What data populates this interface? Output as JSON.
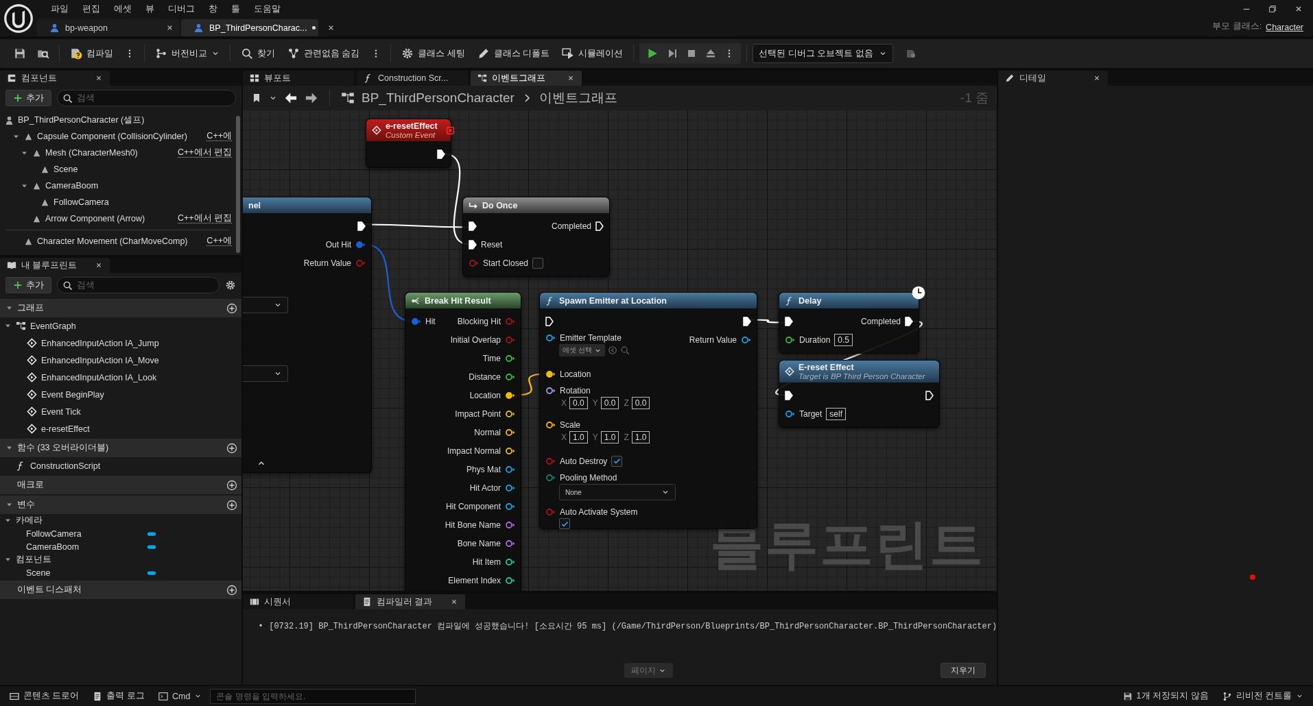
{
  "menu_bar": {
    "items": [
      "파일",
      "편집",
      "에셋",
      "뷰",
      "디버그",
      "창",
      "툴",
      "도움말"
    ]
  },
  "document_tabs": [
    {
      "label": "bp-weapon",
      "selected": false,
      "modified": false
    },
    {
      "label": "BP_ThirdPersonCharac...",
      "selected": true,
      "modified": true
    }
  ],
  "parent_class": {
    "label": "부모 클래스:",
    "value": "Character"
  },
  "toolbar": {
    "buttons": [
      "컴파일",
      "버전비교",
      "찾기",
      "관련없음 숨김",
      "클래스 세팅",
      "클래스 디폴트",
      "시뮬레이션"
    ],
    "debug_object": "선택된 디버그 오브젝트 없음"
  },
  "components_panel": {
    "tab": "컴포넌트",
    "add": "추가",
    "search_placeholder": "검색",
    "tree": [
      {
        "label": "BP_ThirdPersonCharacter (셀프)",
        "children": [
          {
            "label": "Capsule Component (CollisionCylinder)",
            "edit_link": "C++에",
            "expanded": true,
            "children": [
              {
                "label": "Mesh (CharacterMesh0)",
                "edit_link": "C++에서 편집",
                "expanded": true,
                "children": [
                  {
                    "label": "Scene"
                  }
                ]
              },
              {
                "label": "CameraBoom",
                "expanded": true,
                "children": [
                  {
                    "label": "FollowCamera"
                  }
                ]
              },
              {
                "label": "Arrow Component (Arrow)",
                "edit_link": "C++에서 편집"
              }
            ]
          }
        ]
      }
    ],
    "movement": [
      {
        "label": "Character Movement (CharMoveComp)",
        "edit_link": "C++에"
      }
    ]
  },
  "my_blueprint": {
    "tab": "내 블루프린트",
    "add": "추가",
    "search_placeholder": "검색",
    "sections": [
      {
        "title": "그래프",
        "expanded": true,
        "items": [
          {
            "label": "EventGraph",
            "kind": "graph",
            "expanded": true,
            "children": [
              {
                "label": "EnhancedInputAction IA_Jump",
                "kind": "event"
              },
              {
                "label": "EnhancedInputAction IA_Move",
                "kind": "event"
              },
              {
                "label": "EnhancedInputAction IA_Look",
                "kind": "event"
              },
              {
                "label": "Event BeginPlay",
                "kind": "event"
              },
              {
                "label": "Event Tick",
                "kind": "event"
              },
              {
                "label": "e-resetEffect",
                "kind": "event"
              }
            ]
          }
        ]
      },
      {
        "title": "함수 (33 오버라이더블)",
        "expanded": true,
        "items": [
          {
            "label": "ConstructionScript",
            "kind": "function"
          }
        ]
      },
      {
        "title": "매크로"
      },
      {
        "title": "변수",
        "expanded": true,
        "items": [
          {
            "label": "카메라",
            "kind": "category",
            "expanded": true,
            "children": [
              {
                "label": "FollowCamera",
                "kind": "variable"
              },
              {
                "label": "CameraBoom",
                "kind": "variable"
              }
            ]
          },
          {
            "label": "컴포넌트",
            "kind": "category",
            "expanded": true,
            "children": [
              {
                "label": "Scene",
                "kind": "variable"
              }
            ]
          }
        ]
      },
      {
        "title": "이벤트 디스패처"
      }
    ]
  },
  "graph_tabs": [
    {
      "label": "뷰포트",
      "selected": false
    },
    {
      "label": "Construction Scr...",
      "selected": false
    },
    {
      "label": "이벤트그래프",
      "selected": true
    }
  ],
  "breadcrumb": {
    "items": [
      "BP_ThirdPersonCharacter",
      "이벤트그래프"
    ],
    "zoom": "-1 줌"
  },
  "graph": {
    "watermark": "블루프린트",
    "nodes": [
      {
        "title": "e-resetEffect",
        "subtitle": "Custom Event",
        "kind": "event",
        "rows": [
          {
            "right": {
              "kind": "exec",
              "connected": true
            }
          }
        ]
      },
      {
        "title": "nel",
        "kind": "function",
        "advanced_expanded": true,
        "rows": [
          {
            "right": {
              "kind": "exec",
              "connected": true
            }
          },
          {
            "right": {
              "kind": "data",
              "label": "Out Hit",
              "color": "#1a5fd8",
              "connected": true
            }
          },
          {
            "right": {
              "kind": "data",
              "label": "Return Value",
              "color": "#a81414",
              "connected": false
            }
          },
          {
            "kind": "dropdown"
          },
          {
            "kind": "dropdown"
          }
        ]
      },
      {
        "title": "Do Once",
        "kind": "macro",
        "rows": [
          {
            "left": {
              "kind": "exec",
              "connected": true
            },
            "right": {
              "kind": "exec",
              "label": "Completed",
              "connected": false
            }
          },
          {
            "left": {
              "kind": "exec",
              "label": "Reset",
              "connected": true
            }
          },
          {
            "left": {
              "kind": "data",
              "label": "Start Closed",
              "color": "#a81414",
              "connected": false,
              "widget": {
                "kind": "checkbox",
                "checked": false
              }
            }
          }
        ]
      },
      {
        "title": "Break Hit Result",
        "kind": "pure",
        "rows": [
          {
            "left": {
              "kind": "data",
              "label": "Hit",
              "color": "#1a5fd8",
              "connected": true
            },
            "right": {
              "kind": "data",
              "label": "Blocking Hit",
              "color": "#a81414",
              "connected": false
            }
          },
          {
            "right": {
              "kind": "data",
              "label": "Initial Overlap",
              "color": "#a81414",
              "connected": false
            }
          },
          {
            "right": {
              "kind": "data",
              "label": "Time",
              "color": "#38c038",
              "connected": false
            }
          },
          {
            "right": {
              "kind": "data",
              "label": "Distance",
              "color": "#38c038",
              "connected": false
            }
          },
          {
            "right": {
              "kind": "data",
              "label": "Location",
              "color": "#f0b818",
              "connected": true
            }
          },
          {
            "right": {
              "kind": "data",
              "label": "Impact Point",
              "color": "#f0b818",
              "connected": false
            }
          },
          {
            "right": {
              "kind": "data",
              "label": "Normal",
              "color": "#f0b818",
              "connected": false
            }
          },
          {
            "right": {
              "kind": "data",
              "label": "Impact Normal",
              "color": "#f0b818",
              "connected": false
            }
          },
          {
            "right": {
              "kind": "data",
              "label": "Phys Mat",
              "color": "#18a0e8",
              "connected": false
            }
          },
          {
            "right": {
              "kind": "data",
              "label": "Hit Actor",
              "color": "#18a0e8",
              "connected": false
            }
          },
          {
            "right": {
              "kind": "data",
              "label": "Hit Component",
              "color": "#18a0e8",
              "connected": false
            }
          },
          {
            "right": {
              "kind": "data",
              "label": "Hit Bone Name",
              "color": "#b464e8",
              "connected": false
            }
          },
          {
            "right": {
              "kind": "data",
              "label": "Bone Name",
              "color": "#b464e8",
              "connected": false
            }
          },
          {
            "right": {
              "kind": "data",
              "label": "Hit Item",
              "color": "#1ec8a0",
              "connected": false
            }
          },
          {
            "right": {
              "kind": "data",
              "label": "Element Index",
              "color": "#1ec8a0",
              "connected": false
            }
          }
        ]
      },
      {
        "title": "Spawn Emitter at Location",
        "kind": "function",
        "rows": [
          {
            "left": {
              "kind": "exec",
              "connected": false
            },
            "right": {
              "kind": "exec",
              "connected": true
            }
          },
          {
            "left": {
              "kind": "data",
              "label": "Emitter Template",
              "color": "#18a0e8",
              "connected": false,
              "widget": {
                "kind": "asset",
                "value": "에셋 선택"
              }
            },
            "right": {
              "kind": "data",
              "label": "Return Value",
              "color": "#18a0e8",
              "connected": false
            }
          },
          {
            "left": {
              "kind": "data",
              "label": "Location",
              "color": "#f0b818",
              "connected": true
            }
          },
          {
            "left": {
              "kind": "data",
              "label": "Rotation",
              "color": "#9aa0f0",
              "connected": false,
              "widget": {
                "kind": "vector",
                "fields": [
                  {
                    "axis": "X",
                    "value": "0.0"
                  },
                  {
                    "axis": "Y",
                    "value": "0.0"
                  },
                  {
                    "axis": "Z",
                    "value": "0.0"
                  }
                ]
              }
            }
          },
          {
            "left": {
              "kind": "data",
              "label": "Scale",
              "color": "#f0b818",
              "connected": false,
              "widget": {
                "kind": "vector",
                "fields": [
                  {
                    "axis": "X",
                    "value": "1.0"
                  },
                  {
                    "axis": "Y",
                    "value": "1.0"
                  },
                  {
                    "axis": "Z",
                    "value": "1.0"
                  }
                ]
              }
            }
          },
          {
            "left": {
              "kind": "data",
              "label": "Auto Destroy",
              "color": "#a81414",
              "connected": false,
              "widget": {
                "kind": "checkbox",
                "checked": true
              }
            }
          },
          {
            "left": {
              "kind": "data",
              "label": "Pooling Method",
              "color": "#108070",
              "connected": false,
              "widget": {
                "kind": "dropdown",
                "value": "None"
              }
            }
          },
          {
            "left": {
              "kind": "data",
              "label": "Auto Activate System",
              "color": "#a81414",
              "connected": false,
              "stacked": true,
              "widget": {
                "kind": "checkbox",
                "checked": true
              }
            }
          }
        ]
      },
      {
        "title": "Delay",
        "kind": "function",
        "latent": true,
        "rows": [
          {
            "left": {
              "kind": "exec",
              "connected": true
            },
            "right": {
              "kind": "exec",
              "label": "Completed",
              "connected": true
            }
          },
          {
            "left": {
              "kind": "data",
              "label": "Duration",
              "color": "#38c038",
              "connected": false,
              "widget": {
                "kind": "text",
                "value": "0.5"
              }
            }
          }
        ]
      },
      {
        "title": "E-reset Effect",
        "subtitle": "Target is BP Third Person Character",
        "kind": "event_call",
        "rows": [
          {
            "left": {
              "kind": "exec",
              "connected": true
            },
            "right": {
              "kind": "exec",
              "connected": false
            }
          },
          {
            "left": {
              "kind": "data",
              "label": "Target",
              "color": "#18a0e8",
              "connected": false,
              "widget": {
                "kind": "text",
                "value": "self"
              }
            }
          }
        ]
      }
    ]
  },
  "wires": [
    {
      "color": "#ffffff"
    },
    {
      "color": "#ffffff"
    },
    {
      "color": "#1a5fd8"
    },
    {
      "color": "#f0b818"
    },
    {
      "color": "#ffffff"
    },
    {
      "color": "#ffffff"
    }
  ],
  "details_panel": {
    "tab": "디테일"
  },
  "bottom_panel": {
    "tabs": [
      {
        "label": "시퀀서",
        "selected": false
      },
      {
        "label": "컴파일러 결과",
        "selected": true
      }
    ],
    "log": [
      {
        "bullet": "•",
        "text": "[0732.19] BP_ThirdPersonCharacter 컴파일에 성공했습니다! [소요시간 95 ms] (/Game/ThirdPerson/Blueprints/BP_ThirdPersonCharacter.BP_ThirdPersonCharacter)"
      }
    ],
    "page_button": {
      "label": "페이지",
      "disabled": true
    },
    "clear_button": "지우기"
  },
  "status_bar": {
    "content_drawer": "콘텐츠 드로어",
    "output_log": "출력 로그",
    "cmd": "Cmd",
    "console_placeholder": "콘솔 명령을 입력하세요.",
    "unsaved": "1개 저장되지 않음",
    "revision_control": "리비전 컨트롤"
  }
}
